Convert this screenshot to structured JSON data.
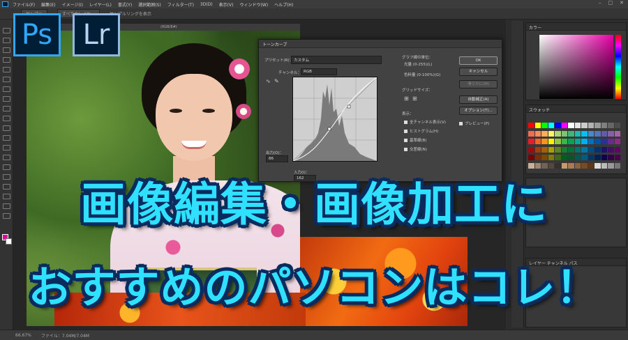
{
  "menubar": {
    "items": [
      "ファイル(F)",
      "編集(E)",
      "イメージ(I)",
      "レイヤー(L)",
      "書式(Y)",
      "選択範囲(S)",
      "フィルター(T)",
      "3D(D)",
      "表示(V)",
      "ウィンドウ(W)",
      "ヘルプ(H)"
    ]
  },
  "optionbar": {
    "items": [
      "サンプル",
      "すべてのレイヤー",
      "サンプルリングを表示"
    ]
  },
  "document": {
    "tab": "(RGB/8#)"
  },
  "logos": {
    "ps": "Ps",
    "lr": "Lr"
  },
  "curves": {
    "title": "トーンカーブ",
    "preset_label": "プリセット(R)：",
    "preset_value": "カスタム",
    "channel_label": "チャンネル：",
    "channel_value": "RGB",
    "output_label": "出力(O)：",
    "output_value": "86",
    "input_label": "入力(I)：",
    "input_value": "162",
    "graph_unit_label": "グラフ線の単位：",
    "unit_light": "光量 (0-255)(L)",
    "unit_ink": "色料量 (0-100%)(G)",
    "grid_size_label": "グリッドサイズ：",
    "show_label": "表示：",
    "options": [
      "全チャンネル表示(V)",
      "ヒストグラム(H)",
      "基準線(B)",
      "交差線(N)"
    ],
    "buttons": {
      "ok": "OK",
      "cancel": "キャンセル",
      "smooth": "滑らかに(M)",
      "auto": "自動補正(A)",
      "options": "オプション(T)..."
    },
    "preview": "プレビュー(P)"
  },
  "panels": {
    "color": "カラー",
    "swatches": "スウォッチ",
    "layers": [
      "レイヤー",
      "チャンネル",
      "パス"
    ]
  },
  "status": {
    "zoom": "66.67%",
    "file": "ファイル：7.04M/7.04M"
  },
  "headline": {
    "line1": "画像編集・画像加工に",
    "line2": "おすすめのパソコンはコレ！"
  },
  "colors": {
    "headline_fill": "#2fe0ff",
    "headline_stroke": "#0a2b5e",
    "ps_blue": "#31a8ff",
    "lr_blue": "#8fb8e4",
    "foreground": "#e200a0"
  }
}
